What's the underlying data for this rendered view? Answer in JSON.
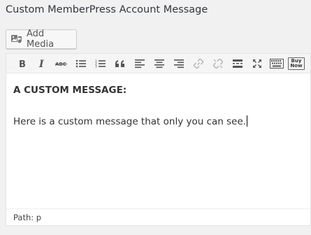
{
  "title": "Custom MemberPress Account Message",
  "add_media_label": "Add Media",
  "toolbar": {
    "buttons": [
      "bold-icon",
      "italic-icon",
      "strikethrough-icon",
      "bulleted-list-icon",
      "numbered-list-icon",
      "blockquote-icon",
      "align-left-icon",
      "align-center-icon",
      "align-right-icon",
      "insert-link-icon",
      "remove-link-icon",
      "read-more-icon",
      "fullscreen-icon",
      "toolbar-toggle-icon",
      "buy-now-icon"
    ],
    "buy_now_line1": "Buy",
    "buy_now_line2": "Now"
  },
  "content": {
    "heading": "A CUSTOM MESSAGE:",
    "paragraph": "Here is a custom message that only you can see."
  },
  "path": "Path: p"
}
